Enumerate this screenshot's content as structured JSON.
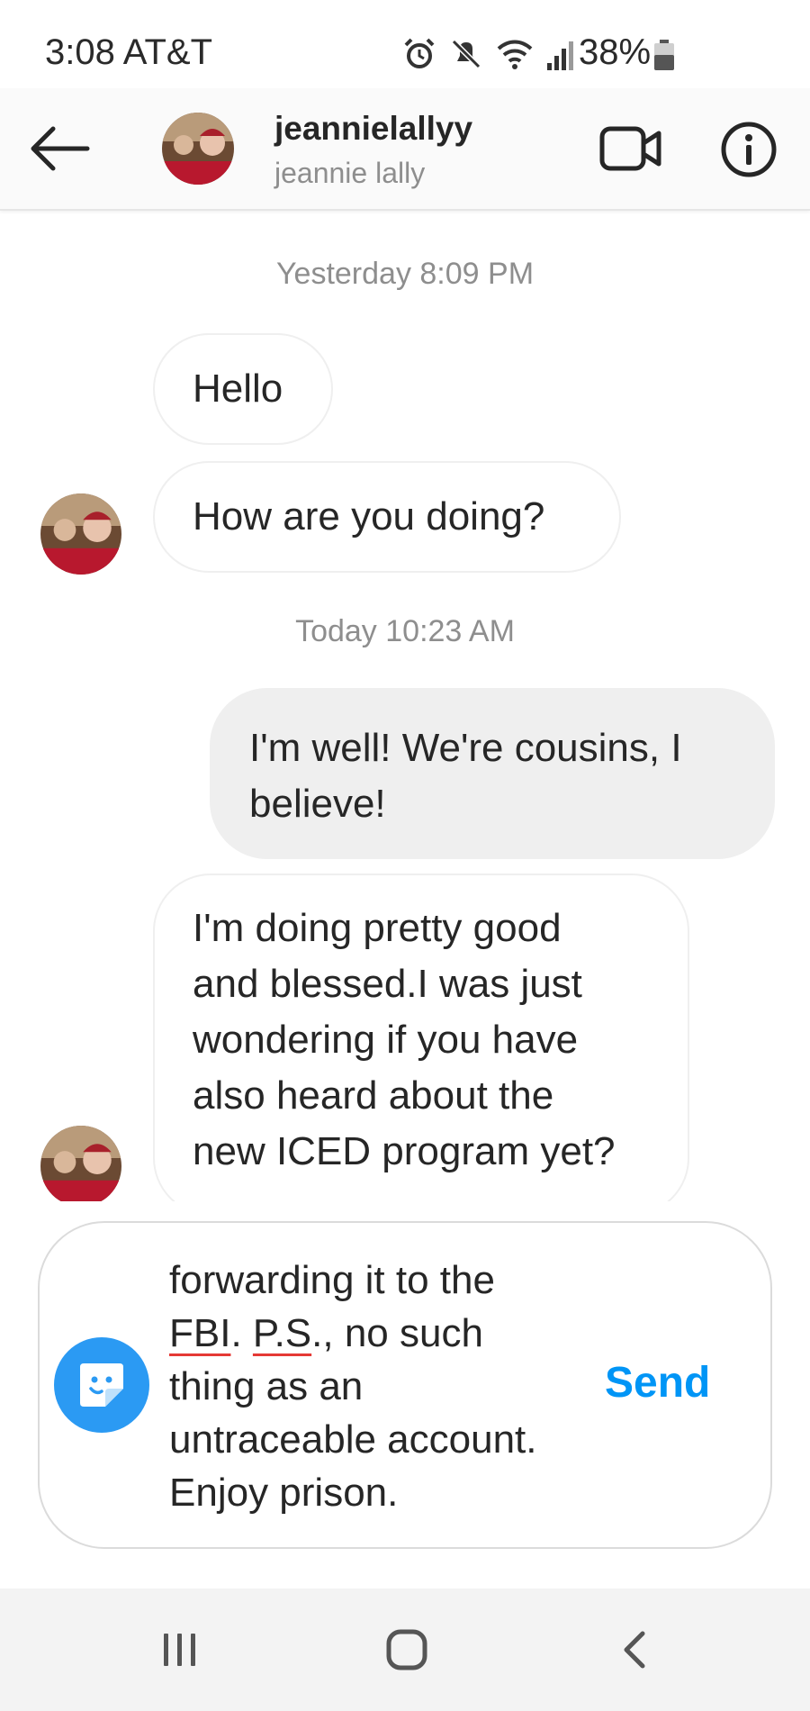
{
  "status_bar": {
    "time_carrier": "3:08 AT&T",
    "battery": "38%",
    "icons": [
      "alarm-icon",
      "mute-icon",
      "wifi-icon",
      "signal-icon",
      "battery-icon"
    ]
  },
  "header": {
    "username": "jeannielallyy",
    "full_name": "jeannie lally",
    "icons": [
      "back-arrow-icon",
      "video-camera-icon",
      "info-icon"
    ]
  },
  "thread": {
    "timestamp_1": "Yesterday 8:09 PM",
    "timestamp_2": "Today 10:23 AM",
    "messages": [
      {
        "sender": "them",
        "lines": [
          "Hello"
        ]
      },
      {
        "sender": "them",
        "lines": [
          "How are you doing?"
        ]
      },
      {
        "sender": "me",
        "lines": [
          "I'm well! We're cousins, I",
          "believe!"
        ]
      },
      {
        "sender": "them",
        "lines": [
          "I'm doing pretty good",
          "and blessed.I was just",
          "wondering if you have",
          "also heard about the",
          "new ICED program yet?"
        ]
      }
    ]
  },
  "composer": {
    "text_lines": [
      "forwarding it to the",
      "FBI",
      ". ",
      "P.S",
      "., no such",
      "thing as an",
      "untraceable account.",
      "Enjoy prison."
    ],
    "send_label": "Send"
  },
  "nav_bar": {
    "icons": [
      "recent-apps-icon",
      "home-icon",
      "back-icon"
    ]
  },
  "colors": {
    "accent": "#0095f6",
    "sticker_button": "#2b9af3",
    "sent_bubble": "#efefef",
    "timestamp": "#8e8e8e",
    "spellcheck": "#e53935"
  }
}
